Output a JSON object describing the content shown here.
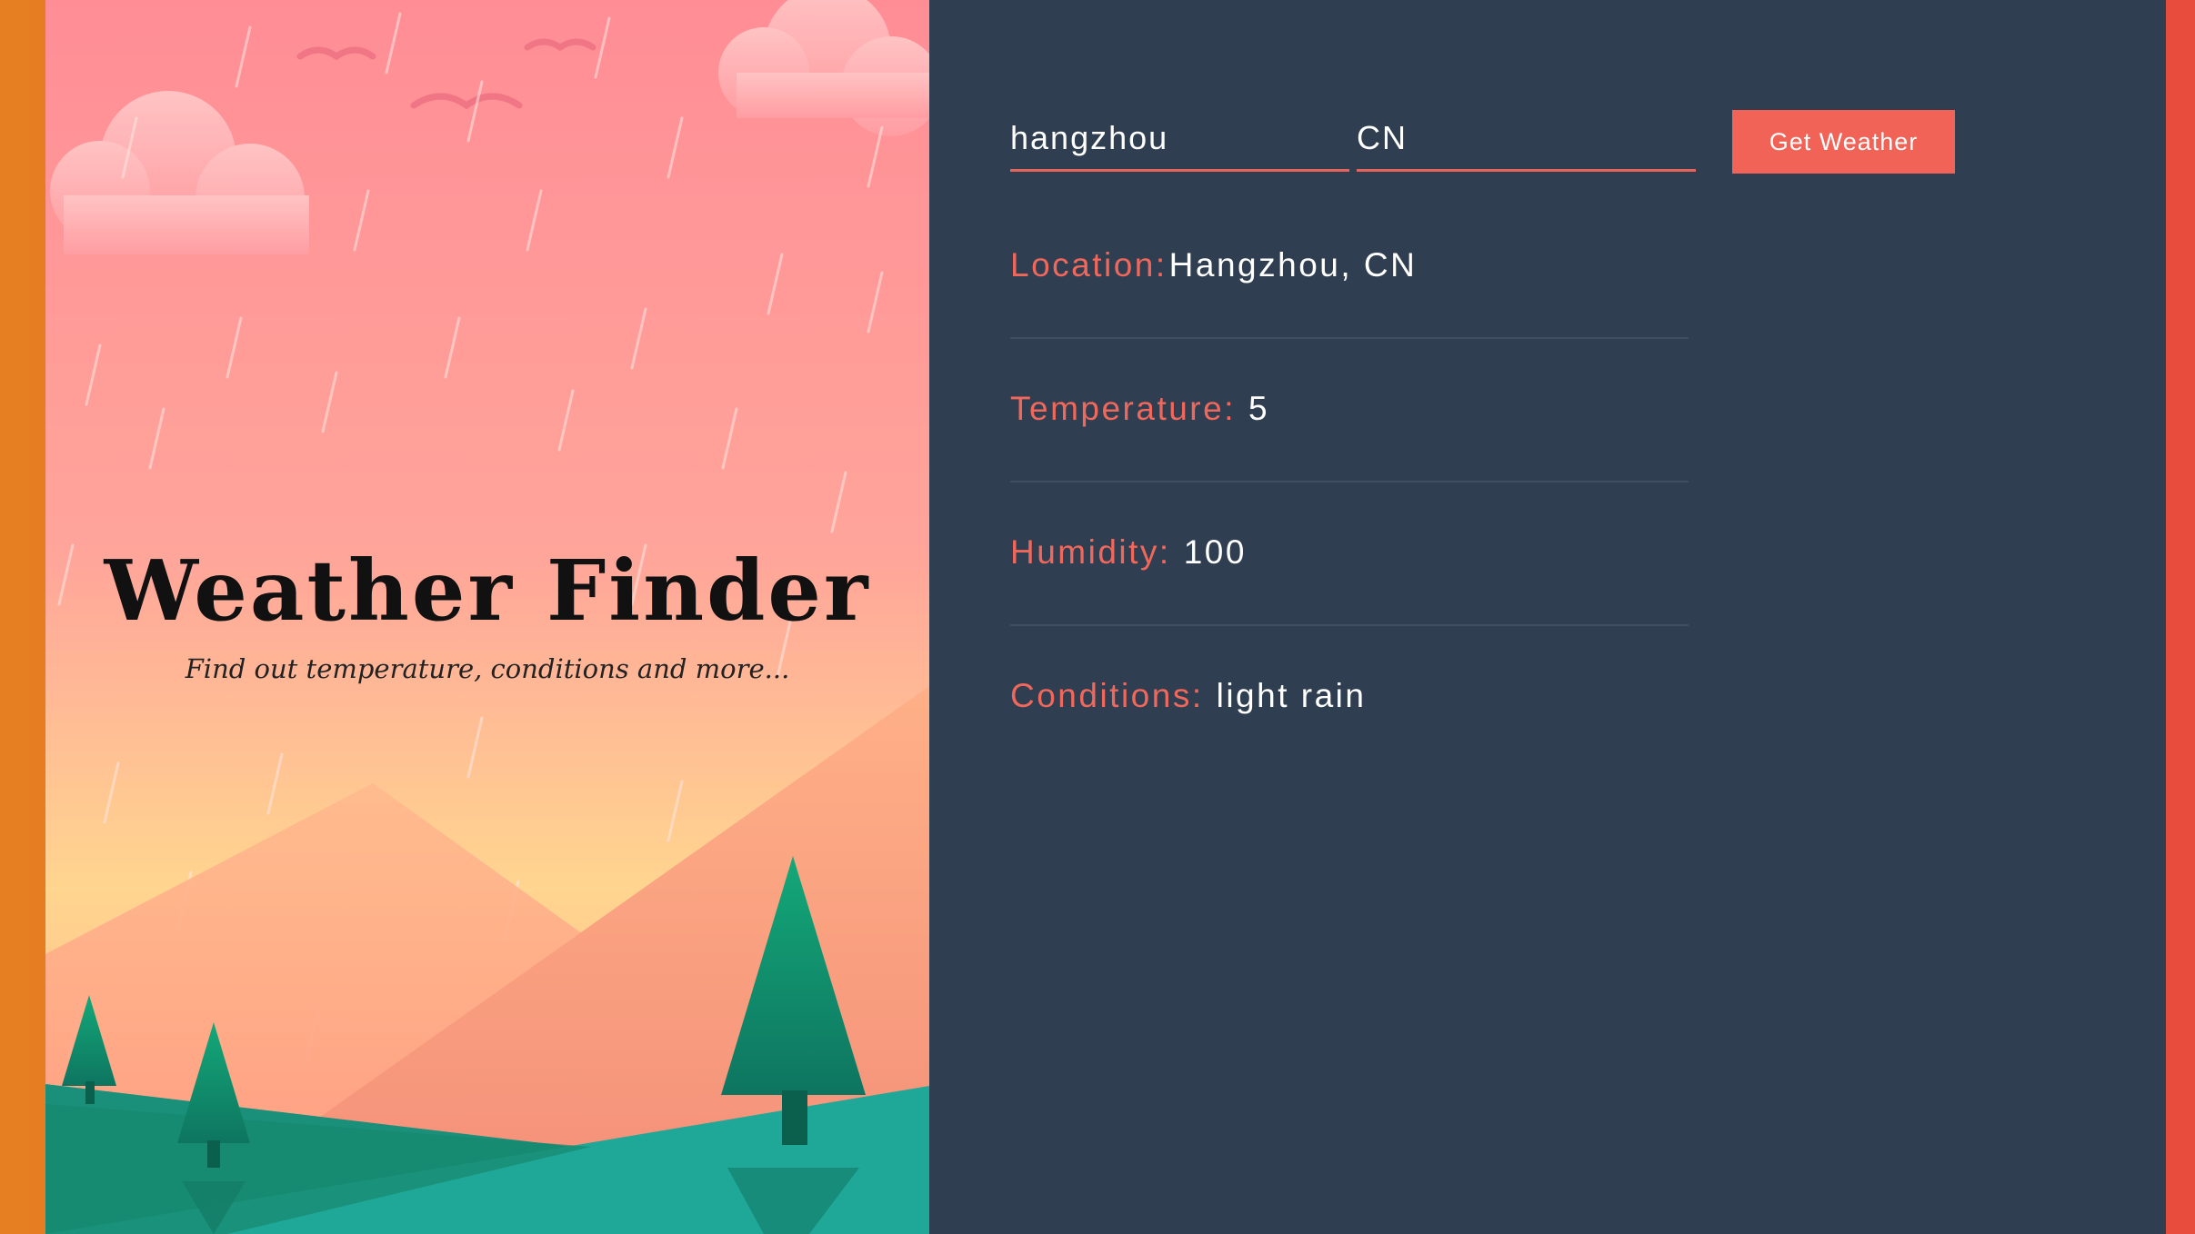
{
  "hero": {
    "title": "Weather Finder",
    "subtitle": "Find out temperature, conditions and more..."
  },
  "form": {
    "city_value": "hangzhou",
    "country_value": "CN",
    "submit_label": "Get Weather"
  },
  "results": {
    "location_label": "Location:",
    "location_value": "Hangzhou, CN",
    "temperature_label": "Temperature:",
    "temperature_value": "5",
    "humidity_label": "Humidity:",
    "humidity_value": "100",
    "conditions_label": "Conditions:",
    "conditions_value": "light rain"
  },
  "colors": {
    "accent": "#f16357",
    "panel": "#2f3e50",
    "frame_left": "#e67e22",
    "frame_right": "#e74c3c"
  }
}
